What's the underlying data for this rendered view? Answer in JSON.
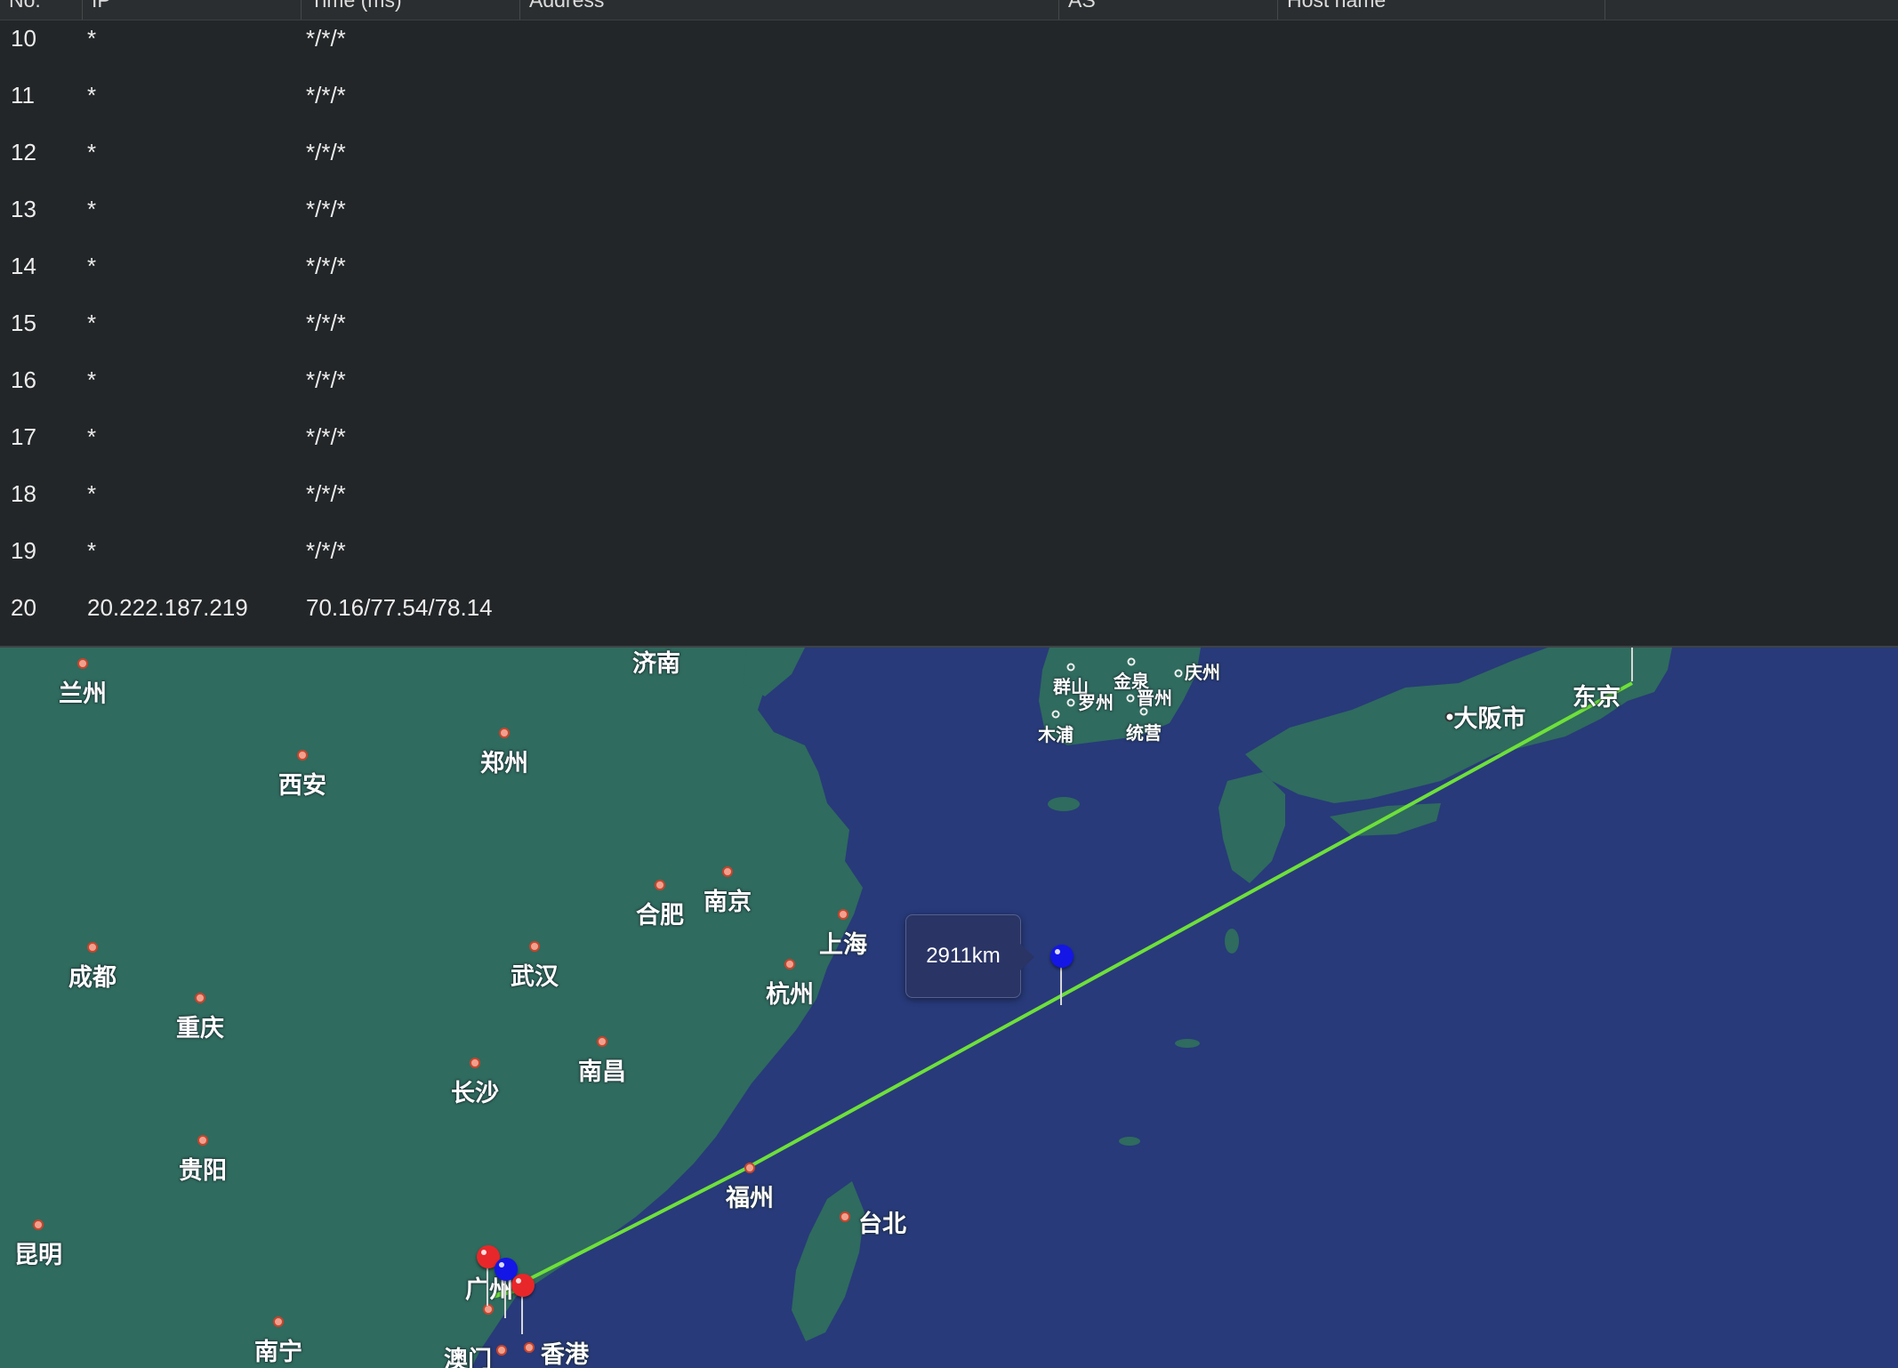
{
  "table": {
    "columns": [
      "No.",
      "IP",
      "Time (ms)",
      "Address",
      "AS",
      "Host name"
    ],
    "rows": [
      {
        "no": "10",
        "ip": "*",
        "time": "*/*/*"
      },
      {
        "no": "11",
        "ip": "*",
        "time": "*/*/*"
      },
      {
        "no": "12",
        "ip": "*",
        "time": "*/*/*"
      },
      {
        "no": "13",
        "ip": "*",
        "time": "*/*/*"
      },
      {
        "no": "14",
        "ip": "*",
        "time": "*/*/*"
      },
      {
        "no": "15",
        "ip": "*",
        "time": "*/*/*"
      },
      {
        "no": "16",
        "ip": "*",
        "time": "*/*/*"
      },
      {
        "no": "17",
        "ip": "*",
        "time": "*/*/*"
      },
      {
        "no": "18",
        "ip": "*",
        "time": "*/*/*"
      },
      {
        "no": "19",
        "ip": "*",
        "time": "*/*/*"
      },
      {
        "no": "20",
        "ip": "20.222.187.219",
        "time": "70.16/77.54/78.14"
      }
    ]
  },
  "map": {
    "distance_label": "2911km",
    "colors": {
      "sea": "#283a7a",
      "land": "#2f6b5e",
      "route": "#6ee03a",
      "pin_blue": "#1416e6",
      "pin_red": "#e8272a"
    },
    "cities": {
      "lanzhou": "兰州",
      "xian": "西安",
      "zhengzhou": "郑州",
      "jinan": "济南",
      "hefei": "合肥",
      "nanjing": "南京",
      "shanghai": "上海",
      "hangzhou": "杭州",
      "chengdu": "成都",
      "chongqing": "重庆",
      "wuhan": "武汉",
      "changsha": "长沙",
      "nanchang": "南昌",
      "guiyang": "贵阳",
      "kunming": "昆明",
      "fuzhou": "福州",
      "taibei": "台北",
      "nanning": "南宁",
      "guangzhou": "广州",
      "aomen": "澳门",
      "xianggang": "香港",
      "gunsan": "群山",
      "gimje": "金泉",
      "gyeongju": "庆州",
      "naju": "罗州",
      "jinju": "晋州",
      "mokpo": "木浦",
      "tongyeong": "统营",
      "osaka": "大阪市",
      "tokyo": "东京"
    }
  }
}
